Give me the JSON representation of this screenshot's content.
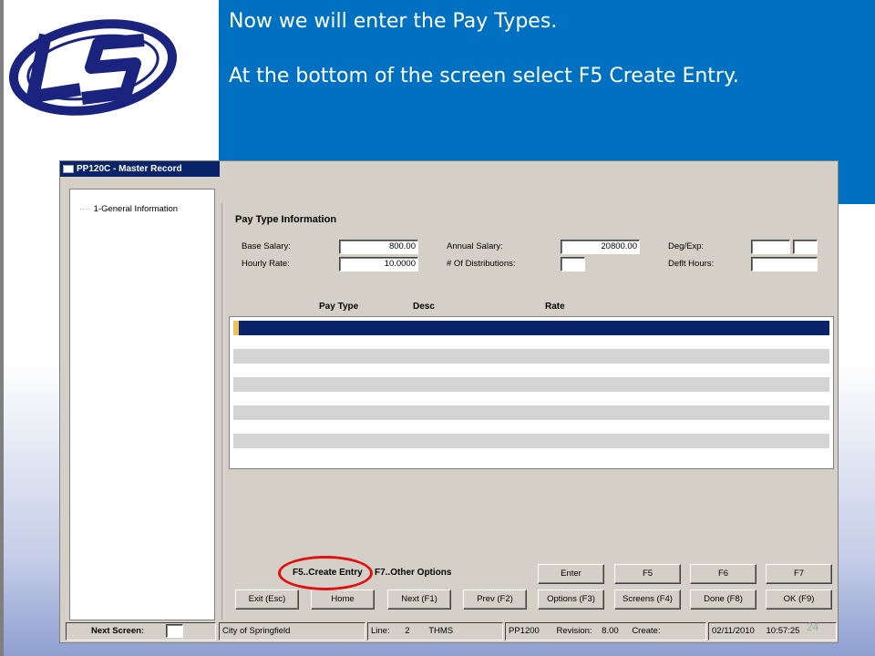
{
  "slide": {
    "instruction_lines": [
      "Now we will enter the Pay Types.",
      "At the bottom of the screen select F5 Create Entry."
    ],
    "page_number": "24"
  },
  "window": {
    "title": "PP120C - Master Record",
    "tree": {
      "items": [
        "1-General Information"
      ]
    }
  },
  "pay_type": {
    "section_title": "Pay Type Information",
    "base_salary_label": "Base Salary:",
    "base_salary_value": "800.00",
    "hourly_rate_label": "Hourly Rate:",
    "hourly_rate_value": "10.0000",
    "annual_salary_label": "Annual Salary:",
    "annual_salary_value": "20800.00",
    "distributions_label": "# Of Distributions:",
    "distributions_value": "",
    "deg_exp_label": "Deg/Exp:",
    "deg_value": "",
    "exp_value": "",
    "deflt_hours_label": "Deflt Hours:",
    "deflt_hours_value": ""
  },
  "grid": {
    "columns": [
      "Pay Type",
      "Desc",
      "Rate"
    ],
    "rows": []
  },
  "hints": {
    "f5": "F5..Create Entry",
    "f7": "F7..Other Options"
  },
  "buttons": {
    "row1": [
      "Enter",
      "F5",
      "F6",
      "F7"
    ],
    "row2": [
      "Exit (Esc)",
      "Home",
      "Next (F1)",
      "Prev (F2)",
      "Options (F3)",
      "Screens (F4)",
      "Done (F8)",
      "OK (F9)"
    ]
  },
  "status": {
    "next_screen_label": "Next Screen:",
    "district": "City of Springfield",
    "line_label": "Line:",
    "line_value": "2",
    "user": "THMS",
    "program": "PP1200",
    "revision_label": "Revision:",
    "revision_value": "8.00",
    "create_label": "Create:",
    "date": "02/11/2010",
    "time": "10:57:25"
  },
  "colors": {
    "banner": "#0070c0",
    "selection": "#0a246a",
    "annotation_circle": "#e01010"
  }
}
